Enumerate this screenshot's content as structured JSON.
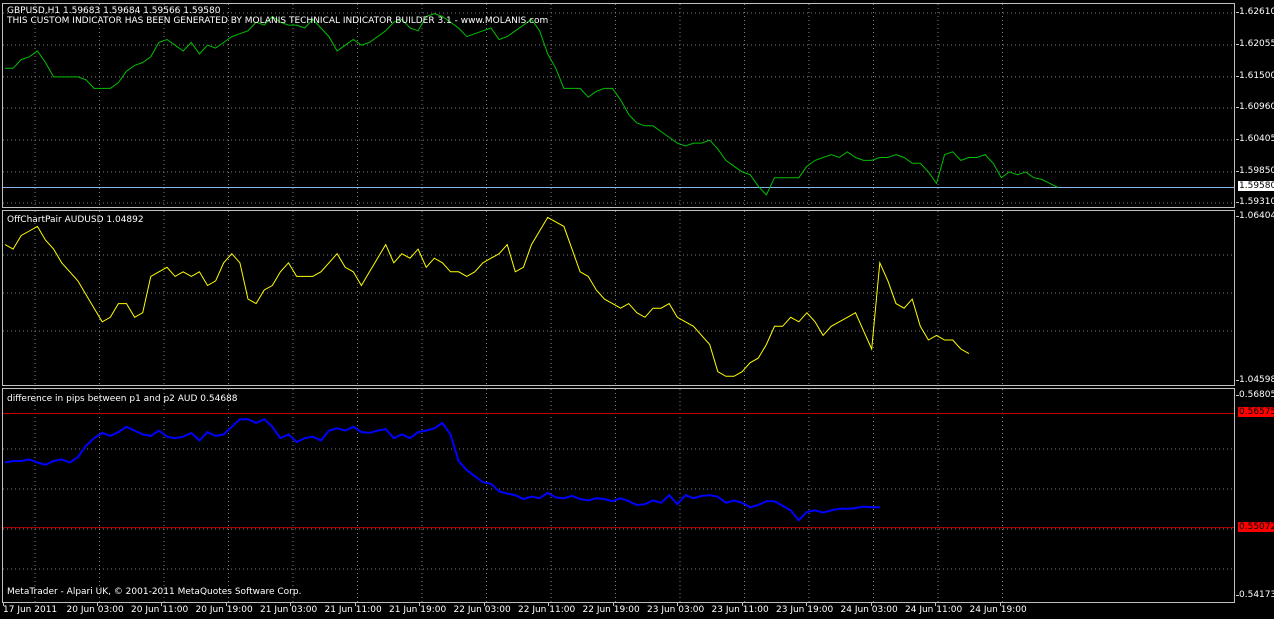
{
  "colors": {
    "background": "#000000",
    "grid": "#808080",
    "main_series": "#00c000",
    "offchart_series": "#ffff00",
    "diff_series": "#0000ff",
    "level_lines": "#c00000",
    "current_price_line": "#8ab4e8",
    "badge_current": "#ffffff",
    "badge_level": "#ff0000"
  },
  "panels": {
    "main": {
      "title": "GBPUSD,H1  1.59683 1.59684 1.59566 1.59580",
      "subtitle": "THIS CUSTOM INDICATOR HAS BEEN GENERATED BY MOLANIS TECHNICAL INDICATOR BUILDER 3.1 - www.MOLANIS.com",
      "axis_labels": [
        "1.62610",
        "1.62055",
        "1.61500",
        "1.60960",
        "1.60405",
        "1.59850",
        "1.59310"
      ],
      "current_price": "1.59580",
      "footer": ""
    },
    "offchart": {
      "title": "OffChartPair AUDUSD    1.04892",
      "axis_labels": [
        "1.06404",
        "1.04598"
      ]
    },
    "diff": {
      "title": "difference in pips between p1 and p2 AUD 0.54688",
      "axis_labels": [
        "0.56805",
        "0.54173"
      ],
      "level_high": "0.56575",
      "level_low": "0.55072",
      "footer": "MetaTrader - Alpari UK, © 2001-2011 MetaQuotes Software Corp."
    }
  },
  "time_axis": [
    "17 Jun 2011",
    "20 Jun 03:00",
    "20 Jun 11:00",
    "20 Jun 19:00",
    "21 Jun 03:00",
    "21 Jun 11:00",
    "21 Jun 19:00",
    "22 Jun 03:00",
    "22 Jun 11:00",
    "22 Jun 19:00",
    "23 Jun 03:00",
    "23 Jun 11:00",
    "23 Jun 19:00",
    "24 Jun 03:00",
    "24 Jun 11:00",
    "24 Jun 19:00"
  ],
  "chart_data": [
    {
      "type": "line",
      "title": "GBPUSD,H1",
      "series": [
        {
          "name": "GBPUSD",
          "values": [
            1.6165,
            1.6165,
            1.618,
            1.6185,
            1.6195,
            1.6175,
            1.615,
            1.615,
            1.615,
            1.615,
            1.6145,
            1.613,
            1.613,
            1.613,
            1.614,
            1.616,
            1.617,
            1.6175,
            1.6185,
            1.621,
            1.6215,
            1.6205,
            1.6195,
            1.621,
            1.619,
            1.6205,
            1.62,
            1.621,
            1.622,
            1.6225,
            1.623,
            1.6245,
            1.624,
            1.6255,
            1.6245,
            1.624,
            1.624,
            1.6235,
            1.625,
            1.6235,
            1.622,
            1.6195,
            1.6205,
            1.6215,
            1.6205,
            1.621,
            1.622,
            1.623,
            1.6245,
            1.625,
            1.6235,
            1.623,
            1.6255,
            1.626,
            1.6255,
            1.6245,
            1.6235,
            1.622,
            1.6225,
            1.623,
            1.6235,
            1.6215,
            1.622,
            1.623,
            1.624,
            1.625,
            1.623,
            1.619,
            1.6165,
            1.613,
            1.613,
            1.613,
            1.6115,
            1.6125,
            1.613,
            1.613,
            1.611,
            1.6085,
            1.607,
            1.6065,
            1.6065,
            1.6055,
            1.6045,
            1.6035,
            1.603,
            1.6035,
            1.6035,
            1.604,
            1.6025,
            1.6005,
            1.5995,
            1.5985,
            1.598,
            1.596,
            1.5945,
            1.5975,
            1.5975,
            1.5975,
            1.5975,
            1.5995,
            1.6005,
            1.601,
            1.6015,
            1.601,
            1.602,
            1.601,
            1.6005,
            1.6005,
            1.601,
            1.601,
            1.6015,
            1.601,
            1.6,
            1.6,
            1.5985,
            1.5965,
            1.6015,
            1.602,
            1.6005,
            1.601,
            1.601,
            1.6015,
            1.6,
            1.5975,
            1.5985,
            1.598,
            1.5985,
            1.5975,
            1.5972,
            1.5965,
            1.5958
          ]
        }
      ],
      "ylim": [
        1.5931,
        1.6261
      ]
    },
    {
      "type": "line",
      "title": "OffChartPair AUDUSD",
      "series": [
        {
          "name": "AUDUSD",
          "values": [
            1.061,
            1.0605,
            1.062,
            1.0625,
            1.063,
            1.0615,
            1.0605,
            1.059,
            1.058,
            1.057,
            1.0555,
            1.054,
            1.0525,
            1.053,
            1.0545,
            1.0545,
            1.053,
            1.0535,
            1.0575,
            1.058,
            1.0585,
            1.0575,
            1.058,
            1.0575,
            1.058,
            1.0565,
            1.057,
            1.059,
            1.06,
            1.059,
            1.055,
            1.0545,
            1.056,
            1.0565,
            1.058,
            1.059,
            1.0575,
            1.0575,
            1.0575,
            1.058,
            1.059,
            1.06,
            1.0585,
            1.058,
            1.0565,
            1.058,
            1.0595,
            1.061,
            1.059,
            1.06,
            1.0595,
            1.0605,
            1.0585,
            1.0595,
            1.059,
            1.058,
            1.058,
            1.0575,
            1.058,
            1.059,
            1.0595,
            1.06,
            1.061,
            1.058,
            1.0585,
            1.061,
            1.0625,
            1.064,
            1.0635,
            1.063,
            1.0605,
            1.058,
            1.0575,
            1.056,
            1.055,
            1.0545,
            1.054,
            1.0545,
            1.0535,
            1.053,
            1.054,
            1.054,
            1.0545,
            1.053,
            1.0525,
            1.052,
            1.051,
            1.05,
            1.047,
            1.0465,
            1.0465,
            1.047,
            1.048,
            1.0485,
            1.05,
            1.052,
            1.052,
            1.053,
            1.0525,
            1.0535,
            1.0525,
            1.051,
            1.052,
            1.0525,
            1.053,
            1.0535,
            1.0515,
            1.0495,
            1.059,
            1.057,
            1.0545,
            1.054,
            1.055,
            1.052,
            1.0505,
            1.051,
            1.0505,
            1.0505,
            1.0495,
            1.049
          ]
        }
      ],
      "ylim": [
        1.04598,
        1.06404
      ]
    },
    {
      "type": "line",
      "title": "difference in pips between p1 and p2 AUD",
      "series": [
        {
          "name": "difference",
          "values": [
            0.5593,
            0.5595,
            0.5595,
            0.5597,
            0.5593,
            0.559,
            0.5595,
            0.5597,
            0.5593,
            0.56,
            0.5615,
            0.5625,
            0.5632,
            0.5628,
            0.5633,
            0.564,
            0.5635,
            0.563,
            0.5628,
            0.5635,
            0.5627,
            0.5625,
            0.5627,
            0.5632,
            0.5622,
            0.5633,
            0.5628,
            0.563,
            0.564,
            0.565,
            0.565,
            0.5645,
            0.565,
            0.564,
            0.5625,
            0.563,
            0.562,
            0.5625,
            0.5627,
            0.5622,
            0.5635,
            0.5638,
            0.5635,
            0.564,
            0.5633,
            0.5632,
            0.5635,
            0.5637,
            0.5625,
            0.563,
            0.5625,
            0.5633,
            0.5635,
            0.5638,
            0.5645,
            0.563,
            0.5595,
            0.5583,
            0.5575,
            0.5567,
            0.5565,
            0.5555,
            0.5552,
            0.555,
            0.5545,
            0.5548,
            0.5546,
            0.5553,
            0.5547,
            0.5546,
            0.5549,
            0.5545,
            0.5543,
            0.5546,
            0.5545,
            0.5542,
            0.5546,
            0.5542,
            0.5537,
            0.5538,
            0.5543,
            0.554,
            0.555,
            0.5538,
            0.555,
            0.5546,
            0.5549,
            0.555,
            0.5548,
            0.554,
            0.5543,
            0.554,
            0.5534,
            0.5537,
            0.5542,
            0.5542,
            0.5536,
            0.553,
            0.5517,
            0.5528,
            0.553,
            0.5527,
            0.553,
            0.5532,
            0.5532,
            0.5533,
            0.5535,
            0.5534,
            0.5534
          ]
        }
      ],
      "ylim": [
        0.54173,
        0.56805
      ],
      "levels": [
        0.56575,
        0.55072
      ]
    }
  ]
}
